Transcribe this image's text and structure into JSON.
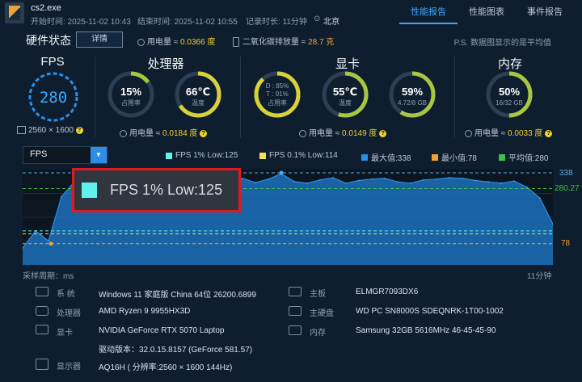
{
  "header": {
    "app_name": "cs2.exe",
    "start_time": "开始时间: 2025-11-02 10:43",
    "end_time": "结束时间: 2025-11-02 10:55",
    "duration": "记录时长: 11分钟",
    "location": "北京",
    "tabs": [
      "性能报告",
      "性能图表",
      "事件报告"
    ],
    "active_tab": 0
  },
  "hardware": {
    "title": "硬件状态",
    "detail_button": "详情",
    "power_label": "用电量 ≈ ",
    "power_value": "0.0366 度",
    "co2_label": "二氧化碳排放量 ≈ ",
    "co2_value": "28.7 克",
    "note": "P.S. 数据图显示的是平均值"
  },
  "groups": {
    "fps": {
      "title": "FPS",
      "value": "280",
      "resolution": "2560 × 1600"
    },
    "cpu": {
      "title": "处理器",
      "usage": "15%",
      "usage_label": "占用率",
      "usage_level": 15,
      "temp": "66℃",
      "temp_label": "温度",
      "temp_level": 66,
      "power_label": "用电量 ≈ ",
      "power_value": "0.0184 度"
    },
    "gpu": {
      "title": "显卡",
      "d_usage": "D : 85%",
      "t_usage": "T : 91%",
      "usage_label": "占用率",
      "usage_level": 88,
      "temp": "55℃",
      "temp_label": "温度",
      "temp_level": 55,
      "vram": "59%",
      "vram_sub": "4.72/8 GB",
      "vram_level": 59,
      "power_label": "用电量 ≈ ",
      "power_value": "0.0149 度"
    },
    "mem": {
      "title": "内存",
      "usage": "50%",
      "usage_sub": "16/32 GB",
      "usage_level": 50,
      "power_label": "用电量 ≈ ",
      "power_value": "0.0033 度"
    }
  },
  "chart_controls": {
    "metric": "FPS",
    "legend": [
      {
        "label": "FPS 1% Low:125",
        "color": "#5ff2ec"
      },
      {
        "label": "FPS 0.1% Low:114",
        "color": "#f1e44c"
      },
      {
        "label": "最大值:338",
        "color": "#2c8ee6"
      },
      {
        "label": "最小值:78",
        "color": "#f0a233"
      },
      {
        "label": "平均值:280",
        "color": "#3fbf4a"
      }
    ]
  },
  "chart_data": {
    "type": "area",
    "series": [
      {
        "values": [
          62,
          125,
          88,
          250,
          305,
          300,
          310,
          315,
          270,
          300,
          308,
          312,
          330,
          316,
          290,
          300,
          320,
          318,
          302,
          315,
          335,
          306,
          300,
          312,
          320,
          300,
          310,
          315,
          318,
          305,
          300,
          312,
          315,
          320,
          318,
          310,
          305,
          300,
          308,
          285,
          245,
          150
        ]
      }
    ],
    "max": 338,
    "min": 78,
    "avg": 280.27,
    "low_1": 125,
    "low_01": 114,
    "y_ticks": [
      "338",
      "280.27",
      "78"
    ],
    "xlabel_left": "采样周期：ms",
    "xlabel_right": "11分钟",
    "ylim": [
      0,
      350
    ]
  },
  "callout": {
    "text": "FPS 1% Low:125",
    "color": "#5ff2ec"
  },
  "system_info": [
    {
      "label": "系  统",
      "value": "Windows 11 家庭版 China 64位 26200.6899",
      "icon": "grid-icon"
    },
    {
      "label": "处理器",
      "value": "AMD Ryzen 9 9955HX3D",
      "icon": "cpu-icon"
    },
    {
      "label": "显卡",
      "value": "NVIDIA GeForce RTX 5070 Laptop",
      "sub": "驱动版本：32.0.15.8157 (GeForce 581.57)",
      "icon": "gpu-icon"
    },
    {
      "label": "显示器",
      "value": "AQ16H ( 分辨率:2560 × 1600 144Hz)",
      "icon": "monitor-icon"
    },
    {
      "label": "主板",
      "value": "ELMGR7093DX6",
      "icon": "board-icon"
    },
    {
      "label": "主硬盘",
      "value": "WD PC SN8000S SDEQNRK-1T00-1002",
      "icon": "disk-icon"
    },
    {
      "label": "内存",
      "value": "Samsung 32GB 5616MHz 46-45-45-90",
      "icon": "ram-icon"
    }
  ]
}
